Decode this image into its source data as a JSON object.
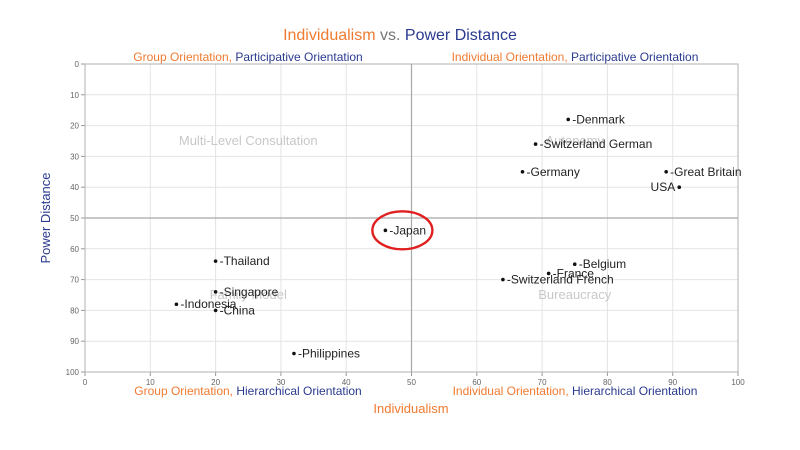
{
  "colors": {
    "orange": "#f07a30",
    "navy": "#2a3a8f",
    "grid": "#e4e4e4",
    "midline": "#a8a8a8",
    "highlight": "#e02020",
    "point": "#111111"
  },
  "title": {
    "part1": "Individualism",
    "connector": " vs. ",
    "part2": "Power Distance"
  },
  "quadrant_labels": {
    "top_left": {
      "a": "Group Orientation,",
      "b": " Participative Orientation"
    },
    "top_right": {
      "a": "Individual Orientation,",
      "b": " Participative Orientation"
    },
    "bottom_left": {
      "a": "Group Orientation,",
      "b": " Hierarchical Orientation"
    },
    "bottom_right": {
      "a": "Individual Orientation,",
      "b": " Hierarchical Orientation"
    }
  },
  "chart_data": {
    "type": "scatter",
    "title": "Individualism vs. Power Distance",
    "xlabel": "Individualism",
    "ylabel": "Power Distance",
    "xlim": [
      0,
      100
    ],
    "ylim": [
      0,
      100
    ],
    "y_reversed": true,
    "xticks": [
      0,
      10,
      20,
      30,
      40,
      50,
      60,
      70,
      80,
      90,
      100
    ],
    "yticks": [
      0,
      10,
      20,
      30,
      40,
      50,
      60,
      70,
      80,
      90,
      100
    ],
    "grid": true,
    "midlines": {
      "x": 50,
      "y": 50
    },
    "zone_labels": [
      {
        "text": "Multi-Level Consultation",
        "x": 25,
        "y": 25
      },
      {
        "text": "Autonomy",
        "x": 75,
        "y": 25
      },
      {
        "text": "Family Model",
        "x": 25,
        "y": 75
      },
      {
        "text": "Bureaucracy",
        "x": 75,
        "y": 75
      }
    ],
    "points": [
      {
        "label": "Denmark",
        "x": 74,
        "y": 18
      },
      {
        "label": "Switzerland German",
        "x": 69,
        "y": 26
      },
      {
        "label": "Germany",
        "x": 67,
        "y": 35
      },
      {
        "label": "Great Britain",
        "x": 89,
        "y": 35
      },
      {
        "label": "USA",
        "x": 91,
        "y": 40
      },
      {
        "label": "Japan",
        "x": 46,
        "y": 54
      },
      {
        "label": "Thailand",
        "x": 20,
        "y": 64
      },
      {
        "label": "Belgium",
        "x": 75,
        "y": 65
      },
      {
        "label": "France",
        "x": 71,
        "y": 68
      },
      {
        "label": "Switzerland French",
        "x": 64,
        "y": 70
      },
      {
        "label": "Singapore",
        "x": 20,
        "y": 74
      },
      {
        "label": "Indonesia",
        "x": 14,
        "y": 78
      },
      {
        "label": "China",
        "x": 20,
        "y": 80
      },
      {
        "label": "Philippines",
        "x": 32,
        "y": 94
      }
    ],
    "highlighted": "Japan"
  }
}
